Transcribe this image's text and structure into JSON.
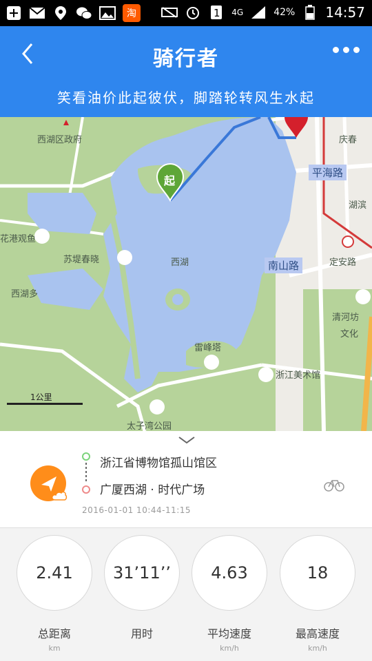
{
  "status_bar": {
    "battery": "42%",
    "network": "4G",
    "time": "14:57",
    "taobao_label": "淘"
  },
  "header": {
    "title": "骑行者",
    "subtitle": "笑看油价此起彼伏，脚踏轮转风生水起"
  },
  "map": {
    "labels": {
      "district": "西湖区政府",
      "pinghai": "平海路",
      "nanshan": "南山路",
      "sudi": "苏堤春晓",
      "xihu": "西湖",
      "leifeng": "雷峰塔",
      "art_museum": "浙江美术馆",
      "park": "太子湾公园",
      "qinghe": "清河坊",
      "wenhua": "文化",
      "qingchun": "庆春",
      "hubin": "湖滨",
      "dingan": "定安路",
      "flower_garden": "花港观鱼",
      "xilidi": "西湖多",
      "start_marker": "起"
    },
    "scale": "1公里"
  },
  "route": {
    "start": "浙江省博物馆孤山馆区",
    "end": "广厦西湖 · 时代广场",
    "datetime": "2016-01-01 10:44-11:15"
  },
  "stats": [
    {
      "value": "2.41",
      "label": "总距离",
      "unit": "km"
    },
    {
      "value": "31’11’’",
      "label": "用时",
      "unit": ""
    },
    {
      "value": "4.63",
      "label": "平均速度",
      "unit": "km/h"
    },
    {
      "value": "18",
      "label": "最高速度",
      "unit": "km/h"
    }
  ],
  "colors": {
    "header": "#2f86ee",
    "water": "#a9c3ef",
    "land": "#b6d39a",
    "route": "#3a78d8",
    "start_marker": "#5ea637",
    "end_marker": "#d4202c",
    "app_icon": "#ff8d1a"
  }
}
